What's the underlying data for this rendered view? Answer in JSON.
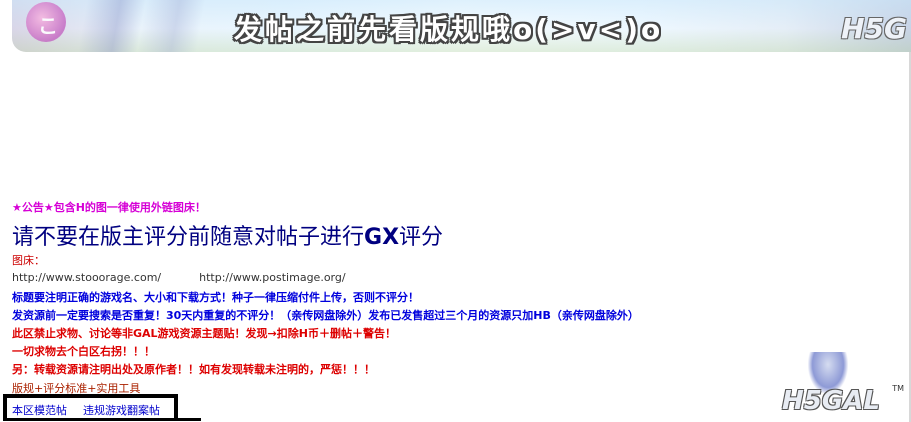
{
  "banner": {
    "title": "发帖之前先看版规哦o(>v<)o",
    "logo": "H5G",
    "heart_glyph": "こ"
  },
  "notice": "★公告★包含H的图一律使用外链图床！",
  "heading": {
    "prefix": "请不要在版主评分前随意对帖子进行",
    "bold": "GX",
    "suffix": "评分"
  },
  "image_host_label": "图床：",
  "image_hosts": [
    "http://www.stooorage.com/",
    "http://www.postimage.org/"
  ],
  "rules": [
    {
      "text": "标题要注明正确的游戏名、大小和下载方式！种子一律压缩付件上传，否则不评分！",
      "color": "blue"
    },
    {
      "text": "发资源前一定要搜索是否重复！30天内重复的不评分！（亲传网盘除外）发布已发售超过三个月的资源只加HB（亲传网盘除外）",
      "color": "blue"
    },
    {
      "text": "此区禁止求物、讨论等非GAL游戏资源主题贴！发现→扣除H币＋删帖＋警告！",
      "color": "red"
    },
    {
      "text": "一切求物去个白区右拐！！！",
      "color": "red"
    },
    {
      "text": "另：转载资源请注明出处及原作者！！如有发现转载未注明的，严惩！！！",
      "color": "red"
    }
  ],
  "bottom_links": "版规+评分标准+实用工具",
  "frame_links": [
    "本区模范帖",
    "违规游戏翻案帖"
  ],
  "mascot_logo": "H5GAL",
  "mascot_tm": "TM"
}
